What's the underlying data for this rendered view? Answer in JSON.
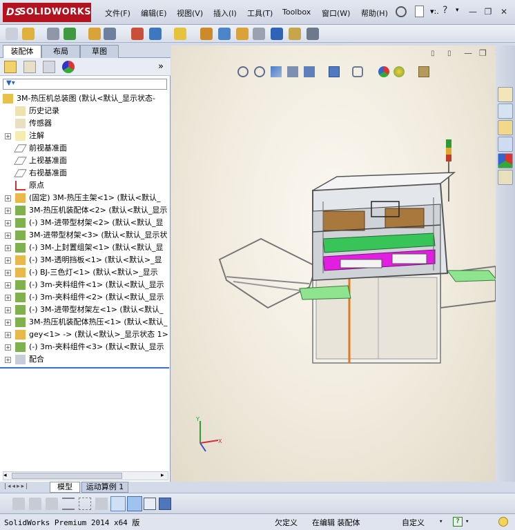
{
  "app": {
    "logo_text": "SOLIDWORKS",
    "logo_prefix": "DS"
  },
  "menu": [
    "文件(F)",
    "编辑(E)",
    "视图(V)",
    "插入(I)",
    "工具(T)",
    "Toolbox",
    "窗口(W)",
    "帮助(H)"
  ],
  "left_tabs": [
    "装配体",
    "布局",
    "草图"
  ],
  "feature_tree": [
    {
      "label": "3M-热压机总装图  (默认<默认_显示状态-",
      "expand": "",
      "icon": "assembly"
    },
    {
      "label": "历史记录",
      "expand": "",
      "icon": "history"
    },
    {
      "label": "传感器",
      "expand": "",
      "icon": "sensor"
    },
    {
      "label": "注解",
      "expand": "+",
      "icon": "annotation"
    },
    {
      "label": "前视基准面",
      "expand": "",
      "icon": "plane"
    },
    {
      "label": "上视基准面",
      "expand": "",
      "icon": "plane"
    },
    {
      "label": "右视基准面",
      "expand": "",
      "icon": "plane"
    },
    {
      "label": "原点",
      "expand": "",
      "icon": "origin"
    },
    {
      "label": "(固定) 3M-热压主架<1> (默认<默认_",
      "expand": "+",
      "icon": "part"
    },
    {
      "label": "3M-热压机装配体<2> (默认<默认_显示",
      "expand": "+",
      "icon": "subassembly"
    },
    {
      "label": "(-) 3M-进带型材架<2> (默认<默认_显",
      "expand": "+",
      "icon": "subassembly"
    },
    {
      "label": "3M-进带型材架<3> (默认<默认_显示状",
      "expand": "+",
      "icon": "subassembly"
    },
    {
      "label": "(-) 3M-上封置组架<1> (默认<默认_显",
      "expand": "+",
      "icon": "subassembly"
    },
    {
      "label": "(-) 3M-透明挡板<1> (默认<默认>_显",
      "expand": "+",
      "icon": "part"
    },
    {
      "label": "(-) BJ-三色灯<1> (默认<默认>_显示",
      "expand": "+",
      "icon": "part"
    },
    {
      "label": "(-) 3m-夹料组件<1> (默认<默认_显示",
      "expand": "+",
      "icon": "subassembly"
    },
    {
      "label": "(-) 3m-夹料组件<2> (默认<默认_显示",
      "expand": "+",
      "icon": "subassembly"
    },
    {
      "label": "(-) 3M-进带型材架左<1> (默认<默认_",
      "expand": "+",
      "icon": "subassembly"
    },
    {
      "label": "3M-热压机装配体热压<1> (默认<默认_",
      "expand": "+",
      "icon": "subassembly"
    },
    {
      "label": "gey<1> -> (默认<默认>_显示状态 1>",
      "expand": "+",
      "icon": "part"
    },
    {
      "label": "(-) 3m-夹料组件<3> (默认<默认_显示",
      "expand": "+",
      "icon": "subassembly"
    },
    {
      "label": "配合",
      "expand": "+",
      "icon": "mates"
    }
  ],
  "bottom_tabs": [
    "模型",
    "运动算例 1"
  ],
  "status": {
    "product": "SolidWorks Premium 2014 x64 版",
    "underdefined": "欠定义",
    "editing": "在编辑 装配体",
    "units": "自定义"
  },
  "colors": {
    "logo_red": "#b3121e",
    "selection_blue": "#3a6fc4"
  }
}
